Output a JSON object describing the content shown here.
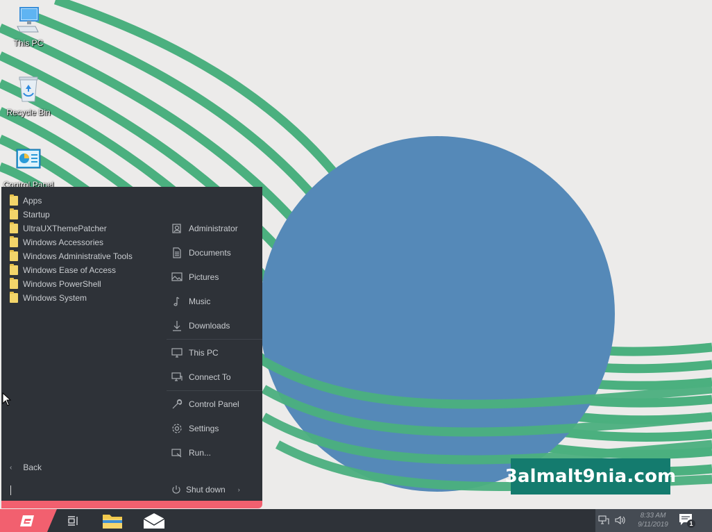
{
  "desktop": {
    "icons": [
      {
        "label": "This PC",
        "icon": "computer-icon"
      },
      {
        "label": "Recycle Bin",
        "icon": "recycle-bin-icon"
      },
      {
        "label": "Control Panel",
        "icon": "control-panel-icon"
      }
    ]
  },
  "start_menu": {
    "folders": [
      {
        "label": "Apps"
      },
      {
        "label": "Startup"
      },
      {
        "label": "UltraUXThemePatcher"
      },
      {
        "label": "Windows Accessories"
      },
      {
        "label": "Windows Administrative Tools"
      },
      {
        "label": "Windows Ease of Access"
      },
      {
        "label": "Windows PowerShell"
      },
      {
        "label": "Windows System"
      }
    ],
    "places": [
      {
        "label": "Administrator",
        "icon": "user-icon"
      },
      {
        "label": "Documents",
        "icon": "document-icon"
      },
      {
        "label": "Pictures",
        "icon": "picture-icon"
      },
      {
        "label": "Music",
        "icon": "music-note-icon"
      },
      {
        "label": "Downloads",
        "icon": "download-icon"
      },
      {
        "label": "This PC",
        "icon": "monitor-icon"
      },
      {
        "label": "Connect To",
        "icon": "network-icon"
      },
      {
        "label": "Control Panel",
        "icon": "wrench-icon"
      },
      {
        "label": "Settings",
        "icon": "gear-icon"
      },
      {
        "label": "Run...",
        "icon": "run-icon"
      }
    ],
    "back_label": "Back",
    "shutdown_label": "Shut down"
  },
  "watermark": {
    "text": "3almalt9nia.com"
  },
  "taskbar": {
    "start_icon": "start-logo-icon",
    "pinned": [
      {
        "name": "task-view",
        "icon": "task-view-icon"
      },
      {
        "name": "file-explorer",
        "icon": "folder-icon"
      },
      {
        "name": "mail",
        "icon": "mail-icon"
      }
    ],
    "tray": {
      "time": "8:33 AM",
      "date": "9/11/2019",
      "notification_count": "1"
    }
  },
  "colors": {
    "menu_bg": "#2e3238",
    "accent": "#f2606f",
    "wallpaper_green": "#4bb07f",
    "wallpaper_circle": "#5589b8",
    "watermark_bg": "#147b6e"
  }
}
